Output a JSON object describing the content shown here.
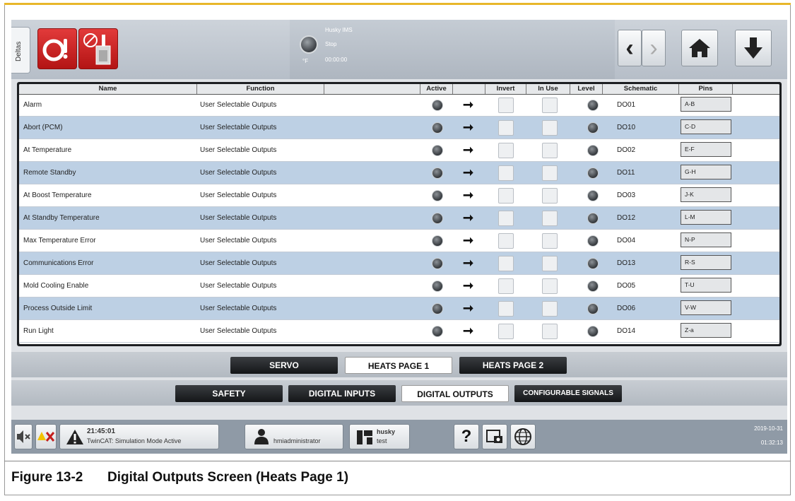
{
  "header": {
    "side_tab": "Deltas",
    "machine_name": "Husky IMS",
    "machine_state": "Stop",
    "timer": "00:00:00",
    "temp_unit": "°F",
    "nav_back": "‹",
    "nav_forward": "›",
    "home_icon": "home-icon",
    "download_icon": "down-arrow-icon"
  },
  "table": {
    "columns": [
      "Name",
      "Function",
      "",
      "Active",
      "",
      "Invert",
      "In Use",
      "Level",
      "Schematic",
      "Pins",
      ""
    ],
    "rows": [
      {
        "name": "Alarm",
        "function": "User Selectable Outputs",
        "schematic": "DO01",
        "pins": "A-B"
      },
      {
        "name": "Abort (PCM)",
        "function": "User Selectable Outputs",
        "schematic": "DO10",
        "pins": "C-D"
      },
      {
        "name": "At Temperature",
        "function": "User Selectable Outputs",
        "schematic": "DO02",
        "pins": "E-F"
      },
      {
        "name": "Remote Standby",
        "function": "User Selectable Outputs",
        "schematic": "DO11",
        "pins": "G-H"
      },
      {
        "name": "At Boost Temperature",
        "function": "User Selectable Outputs",
        "schematic": "DO03",
        "pins": "J-K"
      },
      {
        "name": "At Standby Temperature",
        "function": "User Selectable Outputs",
        "schematic": "DO12",
        "pins": "L-M"
      },
      {
        "name": "Max Temperature Error",
        "function": "User Selectable Outputs",
        "schematic": "DO04",
        "pins": "N-P"
      },
      {
        "name": "Communications Error",
        "function": "User Selectable Outputs",
        "schematic": "DO13",
        "pins": "R-S"
      },
      {
        "name": "Mold Cooling Enable",
        "function": "User Selectable Outputs",
        "schematic": "DO05",
        "pins": "T-U"
      },
      {
        "name": "Process Outside Limit",
        "function": "User Selectable Outputs",
        "schematic": "DO06",
        "pins": "V-W"
      },
      {
        "name": "Run Light",
        "function": "User Selectable Outputs",
        "schematic": "DO14",
        "pins": "Z-a"
      }
    ]
  },
  "tabs_top": [
    {
      "label": "SERVO",
      "active": false
    },
    {
      "label": "HEATS PAGE 1",
      "active": true
    },
    {
      "label": "HEATS PAGE 2",
      "active": false
    }
  ],
  "tabs_bottom": [
    {
      "label": "SAFETY",
      "active": false
    },
    {
      "label": "DIGITAL INPUTS",
      "active": false
    },
    {
      "label": "DIGITAL OUTPUTS",
      "active": true
    },
    {
      "label": "CONFIGURABLE SIGNALS",
      "active": false
    }
  ],
  "bottom_bar": {
    "alarm_time": "21:45:01",
    "alarm_message": "TwinCAT: Simulation Mode Active",
    "user": "hmiadministrator",
    "mold_name": "husky",
    "mold_sub": "test",
    "help": "?",
    "date": "2019-10-31",
    "time": "01:32:13"
  },
  "caption": {
    "number": "Figure 13-2",
    "title": "Digital Outputs Screen (Heats Page 1)"
  },
  "colors": {
    "accent_gold": "#e8b72a",
    "alarm_red": "#c41e1e",
    "row_alt_blue": "#bdd0e4"
  }
}
